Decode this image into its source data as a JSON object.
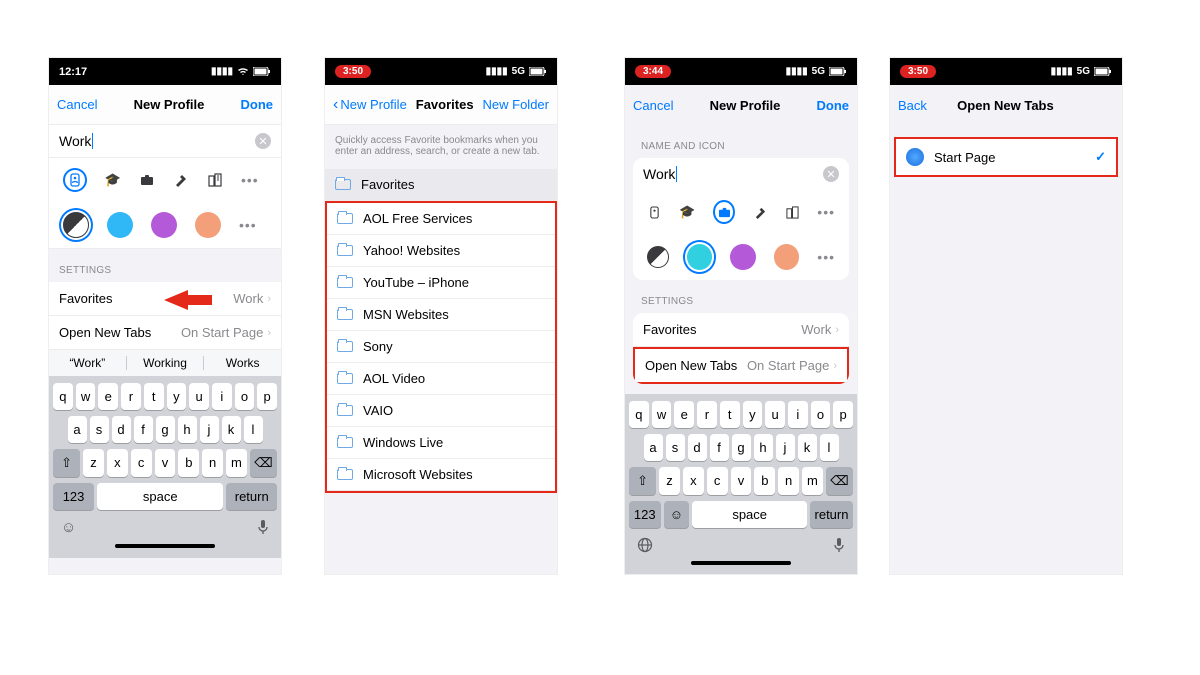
{
  "phone1": {
    "status_time": "12:17",
    "nav": {
      "left": "Cancel",
      "title": "New Profile",
      "right": "Done"
    },
    "name_value": "Work",
    "settings_header": "SETTINGS",
    "favorites": {
      "label": "Favorites",
      "value": "Work"
    },
    "open_tabs": {
      "label": "Open New Tabs",
      "value": "On Start Page"
    },
    "suggestions": [
      "“Work”",
      "Working",
      "Works"
    ],
    "kb_rows": {
      "r1": [
        "q",
        "w",
        "e",
        "r",
        "t",
        "y",
        "u",
        "i",
        "o",
        "p"
      ],
      "r2": [
        "a",
        "s",
        "d",
        "f",
        "g",
        "h",
        "j",
        "k",
        "l"
      ],
      "r3": [
        "z",
        "x",
        "c",
        "v",
        "b",
        "n",
        "m"
      ]
    },
    "kb_labels": {
      "num": "123",
      "space": "space",
      "return": "return"
    }
  },
  "phone2": {
    "status_time": "3:50",
    "status_net": "5G",
    "nav": {
      "left": "New Profile",
      "title": "Favorites",
      "right": "New Folder"
    },
    "hint": "Quickly access Favorite bookmarks when you enter an address, search, or create a new tab.",
    "header_folder": "Favorites",
    "folders": [
      "AOL Free Services",
      "Yahoo! Websites",
      "YouTube – iPhone",
      "MSN Websites",
      "Sony",
      "AOL Video",
      "VAIO",
      "Windows Live",
      "Microsoft Websites"
    ]
  },
  "phone3": {
    "status_time": "3:44",
    "status_net": "5G",
    "nav": {
      "left": "Cancel",
      "title": "New Profile",
      "right": "Done"
    },
    "name_header": "NAME AND ICON",
    "name_value": "Work",
    "settings_header": "SETTINGS",
    "favorites": {
      "label": "Favorites",
      "value": "Work"
    },
    "open_tabs": {
      "label": "Open New Tabs",
      "value": "On Start Page"
    },
    "kb_rows": {
      "r1": [
        "q",
        "w",
        "e",
        "r",
        "t",
        "y",
        "u",
        "i",
        "o",
        "p"
      ],
      "r2": [
        "a",
        "s",
        "d",
        "f",
        "g",
        "h",
        "j",
        "k",
        "l"
      ],
      "r3": [
        "z",
        "x",
        "c",
        "v",
        "b",
        "n",
        "m"
      ]
    },
    "kb_labels": {
      "num": "123",
      "space": "space",
      "return": "return"
    }
  },
  "phone4": {
    "status_time": "3:50",
    "status_net": "5G",
    "nav": {
      "left": "Back",
      "title": "Open New Tabs"
    },
    "start_page": "Start Page"
  },
  "colors": {
    "blue": "#30b7f5",
    "purple": "#b45ad8",
    "orange": "#f3a07a"
  }
}
